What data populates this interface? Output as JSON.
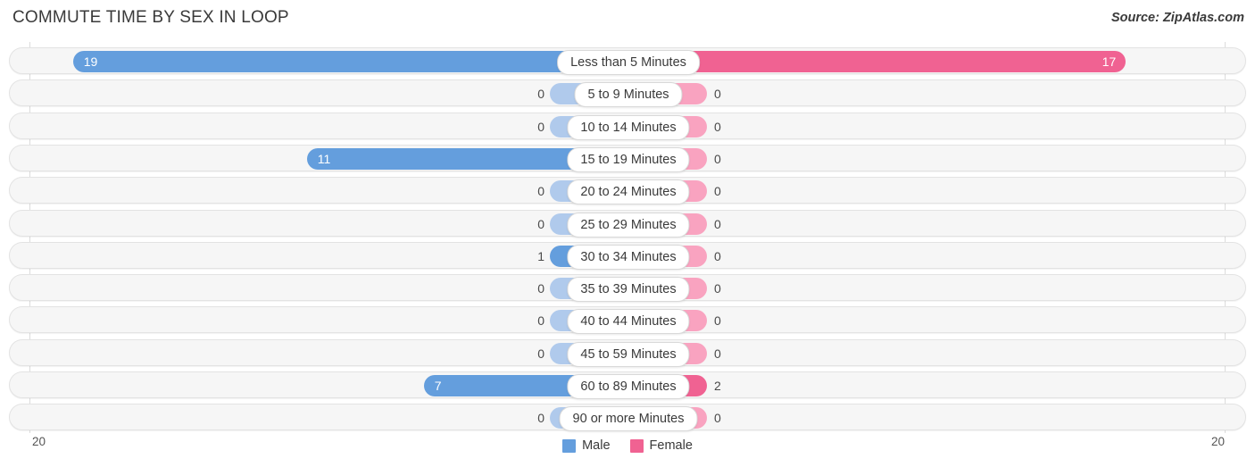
{
  "header": {
    "title": "COMMUTE TIME BY SEX IN LOOP",
    "source": "Source: ZipAtlas.com"
  },
  "legend": {
    "male": {
      "label": "Male",
      "color": "#649edd"
    },
    "female": {
      "label": "Female",
      "color": "#f06292"
    }
  },
  "axis": {
    "left_tick": "20",
    "right_tick": "20"
  },
  "chart_data": {
    "type": "bar",
    "subtype": "diverging-bidirectional",
    "title": "COMMUTE TIME BY SEX IN LOOP",
    "xlabel": "",
    "ylabel": "",
    "xlim": [
      20,
      20
    ],
    "grid": true,
    "legend_position": "bottom-center",
    "categories": [
      "Less than 5 Minutes",
      "5 to 9 Minutes",
      "10 to 14 Minutes",
      "15 to 19 Minutes",
      "20 to 24 Minutes",
      "25 to 29 Minutes",
      "30 to 34 Minutes",
      "35 to 39 Minutes",
      "40 to 44 Minutes",
      "45 to 59 Minutes",
      "60 to 89 Minutes",
      "90 or more Minutes"
    ],
    "series": [
      {
        "name": "Male",
        "color": "#649edd",
        "direction": "left",
        "values": [
          19,
          0,
          0,
          11,
          0,
          0,
          1,
          0,
          0,
          0,
          7,
          0
        ]
      },
      {
        "name": "Female",
        "color": "#f06292",
        "direction": "right",
        "values": [
          17,
          0,
          0,
          0,
          0,
          0,
          0,
          0,
          0,
          0,
          2,
          0
        ]
      }
    ]
  }
}
